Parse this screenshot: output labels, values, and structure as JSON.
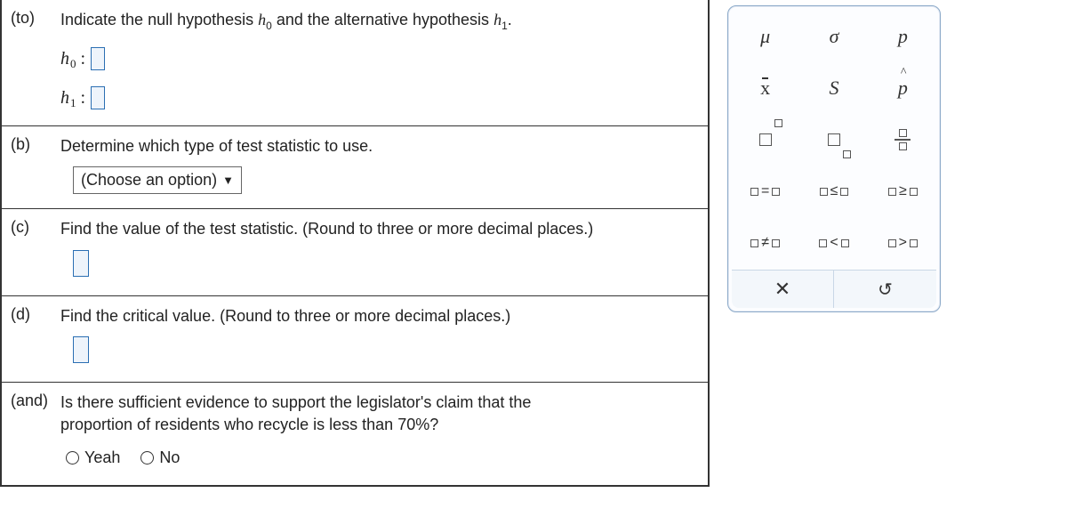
{
  "parts": {
    "a": {
      "label": "(to)",
      "prompt_pre": "Indicate the null hypothesis",
      "prompt_mid": "and the alternative hypothesis",
      "h0_symbol": "h",
      "h0_sub": "0",
      "h1_symbol": "h",
      "h1_sub": "1",
      "colon": ":"
    },
    "b": {
      "label": "(b)",
      "prompt": "Determine which type of test statistic to use.",
      "select_placeholder": "(Choose an option)"
    },
    "c": {
      "label": "(c)",
      "prompt": "Find the value of the test statistic. (Round to three or more decimal places.)"
    },
    "d": {
      "label": "(d)",
      "prompt": "Find the critical value. (Round to three or more decimal places.)"
    },
    "e": {
      "label": "(and)",
      "prompt_line1": "Is there sufficient evidence to support the legislator's claim that the",
      "prompt_line2": "proportion of residents who recycle is less than",
      "prompt_pct": "70%",
      "prompt_q": "?",
      "radio_yes": "Yeah",
      "radio_no": "No"
    }
  },
  "palette": {
    "mu": "μ",
    "sigma": "σ",
    "p": "p",
    "xbar": "x",
    "s": "S",
    "phat": "p",
    "eq": "=",
    "le": "≤",
    "ge": "≥",
    "ne": "≠",
    "lt": "<",
    "gt": ">",
    "clear": "✕",
    "reset": "↺"
  }
}
